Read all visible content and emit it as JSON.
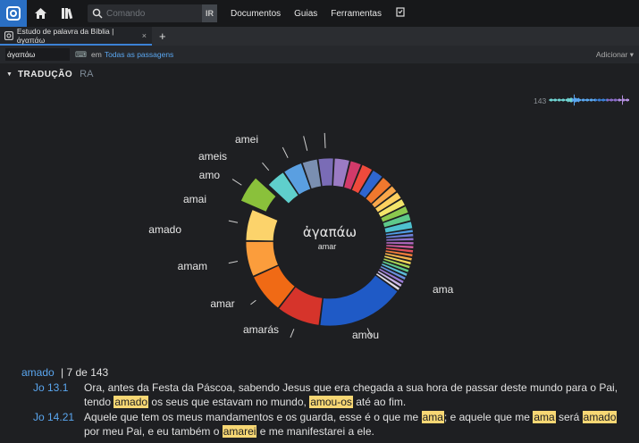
{
  "topbar": {
    "search_placeholder": "Comando",
    "go_label": "IR",
    "menu": [
      "Documentos",
      "Guias",
      "Ferramentas"
    ]
  },
  "tab": {
    "title": "Estudo de palavra da Bíblia | ἀγαπάω",
    "close": "×",
    "add": "+"
  },
  "toolbar": {
    "query": "ἀγαπάω",
    "in_label": "em",
    "scope": "Todas as passagens",
    "add": "Adicionar ▾"
  },
  "section": {
    "title": "TRADUÇÃO",
    "version": "RA",
    "count": "143"
  },
  "chart_data": {
    "type": "pie",
    "title": "ἀγαπάω",
    "subtitle": "amar",
    "highlighted": "amado",
    "slices": [
      {
        "label": "ama",
        "value": 22,
        "color": "#1f5ac6"
      },
      {
        "label": "amou",
        "value": 11,
        "color": "#d6342b"
      },
      {
        "label": "amarás",
        "value": 10,
        "color": "#f06a15"
      },
      {
        "label": "amar",
        "value": 9,
        "color": "#fb9d3c"
      },
      {
        "label": "amam",
        "value": 8,
        "color": "#fcd36b"
      },
      {
        "label": "amado",
        "value": 7,
        "color": "#8ac13b"
      },
      {
        "label": "amai",
        "value": 5,
        "color": "#5fcfcc"
      },
      {
        "label": "amo",
        "value": 5,
        "color": "#5a9fe1"
      },
      {
        "label": "ameis",
        "value": 4,
        "color": "#7a8fb1"
      },
      {
        "label": "amei",
        "value": 4,
        "color": "#7a6cb6"
      },
      {
        "label": "",
        "value": 4,
        "color": "#9b7bc4"
      },
      {
        "label": "",
        "value": 3,
        "color": "#d23a6a"
      },
      {
        "label": "",
        "value": 3,
        "color": "#ef4a3c"
      },
      {
        "label": "",
        "value": 3,
        "color": "#2f66d0"
      },
      {
        "label": "",
        "value": 3,
        "color": "#f0782e"
      },
      {
        "label": "",
        "value": 2,
        "color": "#f8a64a"
      },
      {
        "label": "",
        "value": 2,
        "color": "#fcd060"
      },
      {
        "label": "",
        "value": 2,
        "color": "#f3e46a"
      },
      {
        "label": "",
        "value": 2,
        "color": "#8bc84e"
      },
      {
        "label": "",
        "value": 2,
        "color": "#5ec98a"
      },
      {
        "label": "",
        "value": 2,
        "color": "#4ec1cf"
      },
      {
        "label": "",
        "value": 1,
        "color": "#4f9be3"
      },
      {
        "label": "",
        "value": 1,
        "color": "#6d7fd8"
      },
      {
        "label": "",
        "value": 1,
        "color": "#8a70c9"
      },
      {
        "label": "",
        "value": 1,
        "color": "#b068bf"
      },
      {
        "label": "",
        "value": 1,
        "color": "#d25b9c"
      },
      {
        "label": "",
        "value": 1,
        "color": "#e24f5a"
      },
      {
        "label": "",
        "value": 1,
        "color": "#f07a3a"
      },
      {
        "label": "",
        "value": 1,
        "color": "#f6b04a"
      },
      {
        "label": "",
        "value": 1,
        "color": "#f3d85a"
      },
      {
        "label": "",
        "value": 1,
        "color": "#a6d656"
      },
      {
        "label": "",
        "value": 1,
        "color": "#5ec98a"
      },
      {
        "label": "",
        "value": 1,
        "color": "#5bbcd8"
      },
      {
        "label": "",
        "value": 1,
        "color": "#6a8fe0"
      },
      {
        "label": "",
        "value": 1,
        "color": "#9a7bd6"
      },
      {
        "label": "",
        "value": 1,
        "color": "#c8b4e8"
      },
      {
        "label": "",
        "value": 1,
        "color": "#e0dce8"
      }
    ]
  },
  "results": {
    "word": "amado",
    "count": "| 7 de 143",
    "rows": [
      {
        "ref": "Jo 13.1",
        "parts": [
          {
            "t": "Ora, antes da Festa da Páscoa, sabendo Jesus que era chegada a sua hora de passar deste mundo para o Pai,"
          }
        ]
      },
      {
        "ref": "",
        "parts": [
          {
            "t": "tendo "
          },
          {
            "t": "amado",
            "h": true
          },
          {
            "t": " os seus que estavam no mundo, "
          },
          {
            "t": "amou-os",
            "h": true
          },
          {
            "t": " até ao fim."
          }
        ]
      },
      {
        "ref": "Jo 14.21",
        "parts": [
          {
            "t": "Aquele que tem os meus mandamentos e os guarda, esse é o que me "
          },
          {
            "t": "ama",
            "h": true
          },
          {
            "t": "; e aquele que me "
          },
          {
            "t": "ama",
            "h": true
          },
          {
            "t": " será "
          },
          {
            "t": "amado",
            "h": true
          }
        ]
      },
      {
        "ref": "",
        "parts": [
          {
            "t": "por meu Pai, e eu também o "
          },
          {
            "t": "amarei",
            "h": true
          },
          {
            "t": " e me manifestarei a ele."
          }
        ]
      }
    ]
  }
}
